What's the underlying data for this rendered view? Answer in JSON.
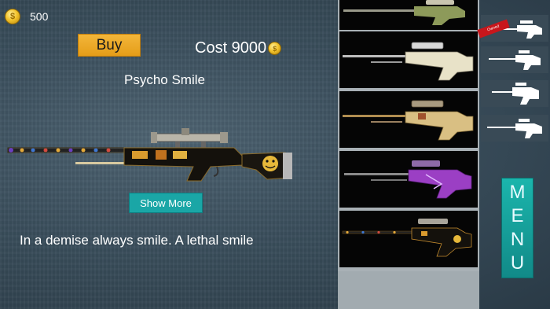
{
  "hud": {
    "coins": "500",
    "coin_symbol": "$"
  },
  "shop": {
    "buy_label": "Buy",
    "cost_label": "Cost 9000",
    "skin_name": "Psycho Smile",
    "show_more_label": "Show More",
    "description": "In a demise always smile. A lethal smile"
  },
  "skins": [
    {
      "name": "camo-skin",
      "color": "#8d9a5a"
    },
    {
      "name": "white-skin",
      "color": "#e8e2c8"
    },
    {
      "name": "tan-skin",
      "color": "#d9bf83"
    },
    {
      "name": "purple-skin",
      "color": "#9b3fc4"
    },
    {
      "name": "psycho-smile-skin",
      "color": "#c28a2e"
    }
  ],
  "categories": {
    "owned_badge": "Owned",
    "items": [
      "rifle-1",
      "rifle-2",
      "rifle-3",
      "rifle-4"
    ]
  },
  "menu": {
    "letters": [
      "M",
      "E",
      "N",
      "U"
    ]
  },
  "colors": {
    "accent": "#1aa6a6",
    "buy": "#eea92a",
    "ribbon": "#c8161b"
  }
}
